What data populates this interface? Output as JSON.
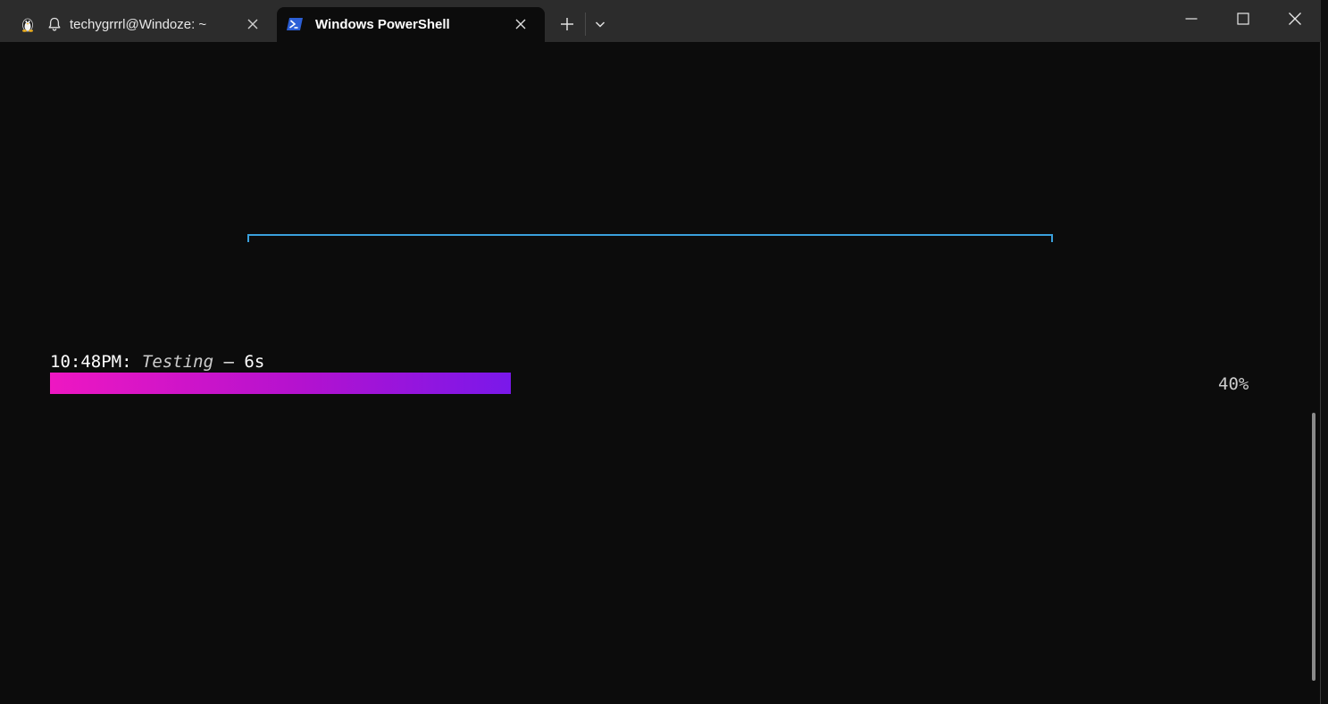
{
  "tabs": [
    {
      "label": "techygrrrl@Windoze: ~",
      "icon": "linux-penguin-icon",
      "bell_icon": "bell-icon",
      "active": false
    },
    {
      "label": "Windows PowerShell",
      "icon": "powershell-icon",
      "active": true
    }
  ],
  "titlebar": {
    "new_tab_icon": "plus-icon",
    "dropdown_icon": "chevron-down-icon",
    "minimize_icon": "minimize-icon",
    "maximize_icon": "maximize-icon",
    "close_icon": "close-icon"
  },
  "terminal": {
    "time": "10:48PM",
    "separator": ": ",
    "activity": "Testing",
    "dash": " – ",
    "elapsed": "6s",
    "progress_percent_text": "40%",
    "progress_fraction": 0.4
  },
  "colors": {
    "background": "#0c0c0c",
    "titlebar": "#2c2c2c",
    "bracket": "#3aa0dc",
    "gradient_start": "#ee17c2",
    "gradient_end": "#7a18ea"
  }
}
